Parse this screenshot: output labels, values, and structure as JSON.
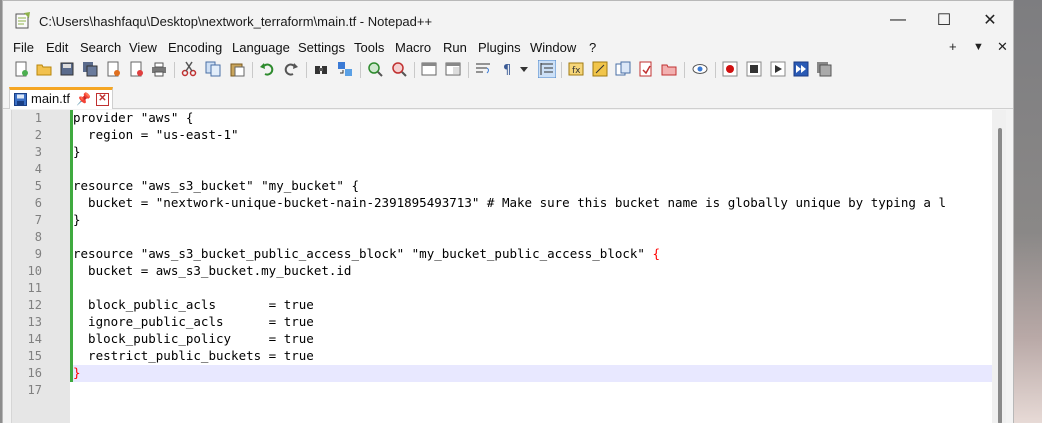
{
  "window": {
    "title": "C:\\Users\\hashfaqu\\Desktop\\nextwork_terraform\\main.tf - Notepad++",
    "minimize_glyph": "—",
    "maximize_glyph": "☐",
    "close_glyph": "✕"
  },
  "menu": {
    "items": [
      "File",
      "Edit",
      "Search",
      "View",
      "Encoding",
      "Language",
      "Settings",
      "Tools",
      "Macro",
      "Run",
      "Plugins",
      "Window",
      "?"
    ],
    "right_plus": "+",
    "right_arrow": "▼",
    "right_close": "✕"
  },
  "toolbar": {
    "icons": [
      "new-file-icon",
      "open-file-icon",
      "save-icon",
      "save-all-icon",
      "close-icon",
      "close-all-icon",
      "print-icon",
      "cut-icon",
      "copy-icon",
      "paste-icon",
      "undo-icon",
      "redo-icon",
      "find-icon",
      "replace-icon",
      "zoom-in-icon",
      "zoom-out-icon",
      "sync-vertical-icon",
      "sync-horizontal-icon",
      "word-wrap-icon",
      "show-all-chars-icon",
      "indent-guide-icon",
      "function-list-icon",
      "folder-workspace-icon",
      "doc-map-icon",
      "doc-list-icon",
      "monitoring-icon",
      "record-macro-icon",
      "stop-record-icon",
      "play-macro-icon",
      "run-macro-multiple-icon",
      "save-macro-icon"
    ]
  },
  "tab": {
    "label": "main.tf",
    "pin_glyph": "📌",
    "close_glyph": "✕"
  },
  "editor": {
    "line_numbers": [
      "1",
      "2",
      "3",
      "4",
      "5",
      "6",
      "7",
      "8",
      "9",
      "10",
      "11",
      "12",
      "13",
      "14",
      "15",
      "16",
      "17"
    ],
    "lines": [
      "provider \"aws\" {",
      "  region = \"us-east-1\"",
      "}",
      "",
      "resource \"aws_s3_bucket\" \"my_bucket\" {",
      "  bucket = \"nextwork-unique-bucket-nain-2391895493713\" # Make sure this bucket name is globally unique by typing a l",
      "}",
      "",
      "resource \"aws_s3_bucket_public_access_block\" \"my_bucket_public_access_block\" ",
      "  bucket = aws_s3_bucket.my_bucket.id",
      "",
      "  block_public_acls       = true",
      "  ignore_public_acls      = true",
      "  block_public_policy     = true",
      "  restrict_public_buckets = true",
      "",
      ""
    ],
    "brace_line9": "{",
    "brace_line16": "}",
    "current_line": 16
  },
  "colors": {
    "accent_tab": "#f5a623",
    "fold_bar": "#3faa3f",
    "highlight_brace": "#ff0000",
    "current_line": "#e8e8ff"
  }
}
